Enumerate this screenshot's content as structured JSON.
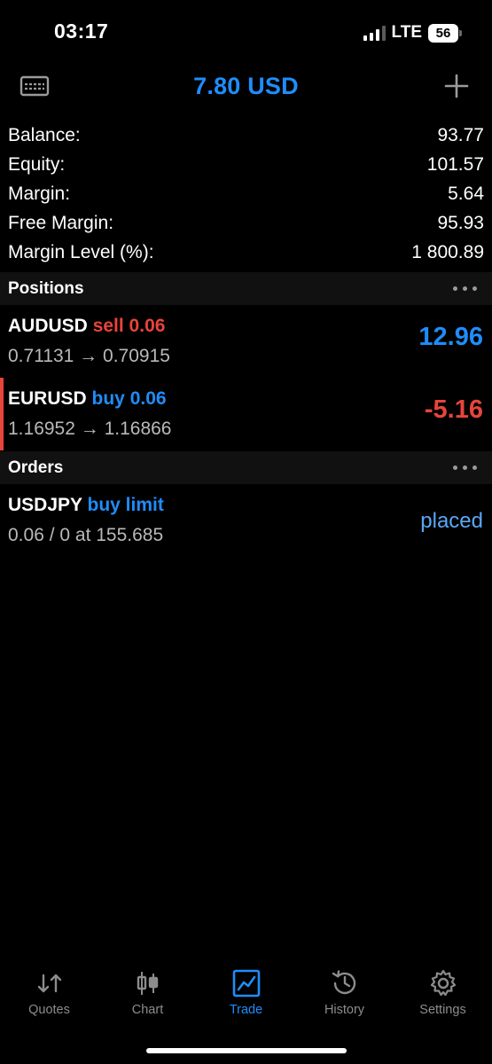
{
  "status_bar": {
    "time": "03:17",
    "network": "LTE",
    "battery": "56"
  },
  "header": {
    "title": "7.80 USD",
    "left_icon": "account-card-icon",
    "right_icon": "plus-icon"
  },
  "summary": [
    {
      "label": "Balance:",
      "value": "93.77"
    },
    {
      "label": "Equity:",
      "value": "101.57"
    },
    {
      "label": "Margin:",
      "value": "5.64"
    },
    {
      "label": "Free Margin:",
      "value": "95.93"
    },
    {
      "label": "Margin Level (%):",
      "value": "1 800.89"
    }
  ],
  "positions": {
    "title": "Positions",
    "items": [
      {
        "symbol": "AUDUSD",
        "side": "sell 0.06",
        "prices": "0.71131 → 0.70915",
        "profit": "12.96"
      },
      {
        "symbol": "EURUSD",
        "side": "buy 0.06",
        "prices": "1.16952 → 1.16866",
        "profit": "-5.16"
      }
    ]
  },
  "orders": {
    "title": "Orders",
    "items": [
      {
        "symbol": "USDJPY",
        "type": "buy limit",
        "details": "0.06 / 0 at 155.685",
        "status": "placed"
      }
    ]
  },
  "tabs": [
    {
      "label": "Quotes",
      "icon": "quotes-arrows-icon"
    },
    {
      "label": "Chart",
      "icon": "candlestick-chart-icon"
    },
    {
      "label": "Trade",
      "icon": "trade-chart-icon",
      "active": true
    },
    {
      "label": "History",
      "icon": "history-clock-icon"
    },
    {
      "label": "Settings",
      "icon": "settings-gear-icon"
    }
  ],
  "colors": {
    "accent": "#1f8dfa",
    "negative": "#e8443a",
    "background": "#000000",
    "section_bg": "#111111"
  }
}
